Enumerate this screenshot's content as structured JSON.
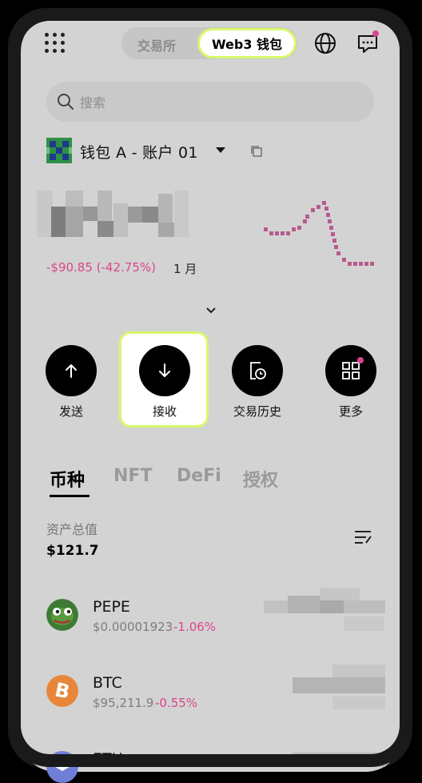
{
  "header": {
    "tabs": [
      {
        "label": "交易所",
        "active": false
      },
      {
        "label": "Web3 钱包",
        "active": true
      }
    ],
    "icons": [
      "grid-menu-icon",
      "globe-icon",
      "message-icon"
    ],
    "notification_dot_color": "#d9468b"
  },
  "search": {
    "placeholder": "搜索"
  },
  "wallet": {
    "name": "钱包 A - 账户 01",
    "balance_hidden": true,
    "pnl": "-$90.85 (-42.75%)",
    "pnl_period": "1 月",
    "pnl_color": "#d9468b"
  },
  "actions": [
    {
      "label": "发送",
      "icon": "arrow-up-icon"
    },
    {
      "label": "接收",
      "icon": "arrow-down-icon",
      "highlighted": true
    },
    {
      "label": "交易历史",
      "icon": "history-icon"
    },
    {
      "label": "更多",
      "icon": "more-grid-icon"
    }
  ],
  "asset_tabs": [
    {
      "label": "币种",
      "active": true
    },
    {
      "label": "NFT",
      "active": false
    },
    {
      "label": "DeFi",
      "active": false
    },
    {
      "label": "授权",
      "active": false
    }
  ],
  "total": {
    "label": "资产总值",
    "value": "$121.7"
  },
  "tokens": [
    {
      "symbol": "PEPE",
      "price": "$0.00001923",
      "change": "-1.06%",
      "logo": "pepe-frog-icon"
    },
    {
      "symbol": "BTC",
      "price": "$95,211.9",
      "change": "-0.55%",
      "logo": "bitcoin-icon"
    },
    {
      "symbol": "ETH",
      "price": "",
      "change": "",
      "logo": "ethereum-icon"
    }
  ],
  "colors": {
    "accent_highlight": "#d8f86c",
    "negative": "#d9468b"
  }
}
